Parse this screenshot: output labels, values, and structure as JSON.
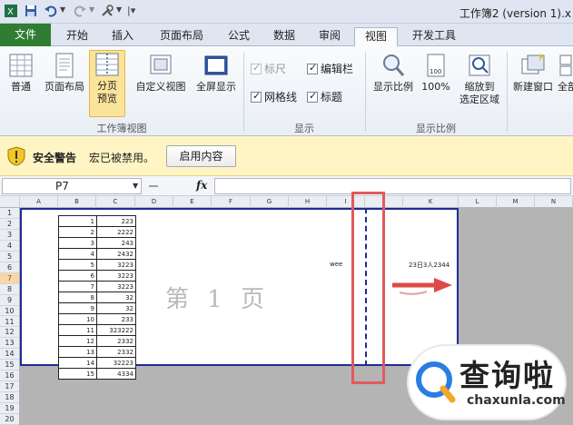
{
  "window": {
    "title": "工作簿2 (version 1).x"
  },
  "tabs": [
    {
      "label": "文件"
    },
    {
      "label": "开始"
    },
    {
      "label": "插入"
    },
    {
      "label": "页面布局"
    },
    {
      "label": "公式"
    },
    {
      "label": "数据"
    },
    {
      "label": "审阅"
    },
    {
      "label": "视图"
    },
    {
      "label": "开发工具"
    }
  ],
  "ribbon": {
    "workbook_views": {
      "group_label": "工作簿视图",
      "normal": "普通",
      "page_layout": "页面布局",
      "page_break_1": "分页",
      "page_break_2": "预览",
      "custom_view": "自定义视图",
      "full_screen": "全屏显示"
    },
    "show": {
      "group_label": "显示",
      "ruler": "标尺",
      "formula_bar": "编辑栏",
      "gridlines": "网格线",
      "headings": "标题"
    },
    "zoom": {
      "group_label": "显示比例",
      "zoom": "显示比例",
      "hundred": "100%",
      "zoom_sel_1": "缩放到",
      "zoom_sel_2": "选定区域"
    },
    "window_group": {
      "new_window": "新建窗口",
      "arrange_all": "全部"
    }
  },
  "security": {
    "title": "安全警告",
    "message": "宏已被禁用。",
    "button": "启用内容"
  },
  "formula_bar": {
    "name_box": "P7",
    "fx": "fx",
    "value": ""
  },
  "columns": [
    "A",
    "B",
    "C",
    "D",
    "E",
    "F",
    "G",
    "H",
    "I",
    "J",
    "K",
    "L",
    "M",
    "N"
  ],
  "rows": [
    "1",
    "2",
    "3",
    "4",
    "5",
    "6",
    "7",
    "8",
    "9",
    "10",
    "11",
    "12",
    "13",
    "14",
    "15",
    "16",
    "17",
    "18",
    "19",
    "20"
  ],
  "table": [
    [
      "1",
      "223"
    ],
    [
      "2",
      "2222"
    ],
    [
      "3",
      "243"
    ],
    [
      "4",
      "2432"
    ],
    [
      "5",
      "3223"
    ],
    [
      "6",
      "3223"
    ],
    [
      "7",
      "3223"
    ],
    [
      "8",
      "32"
    ],
    [
      "9",
      "32"
    ],
    [
      "10",
      "233"
    ],
    [
      "11",
      "323222"
    ],
    [
      "12",
      "2332"
    ],
    [
      "13",
      "2332"
    ],
    [
      "14",
      "32223"
    ],
    [
      "15",
      "4334"
    ]
  ],
  "sheet": {
    "watermark": "第 1 页",
    "cell_i6": "wee",
    "cell_k6": "23日3人2344"
  },
  "brand": {
    "name": "查询啦",
    "url": "chaxunla.com"
  },
  "colors": {
    "file_tab": "#2f7d33",
    "page_border": "#1f2c95",
    "highlight_box": "#e05b5b",
    "arrow": "#e04848"
  }
}
